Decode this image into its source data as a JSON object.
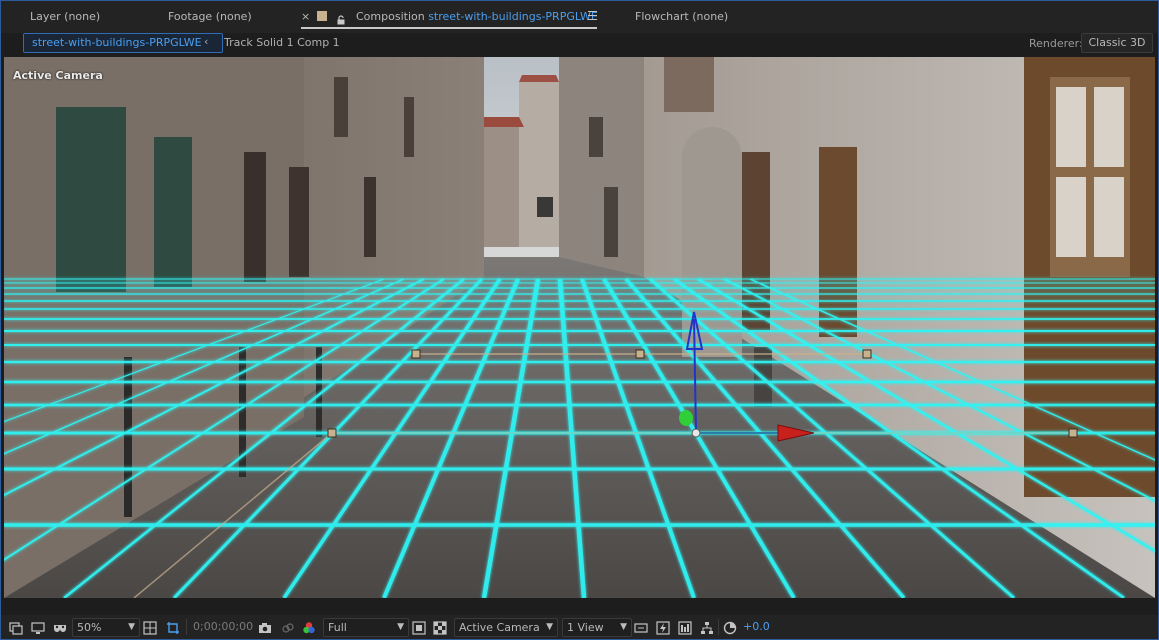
{
  "panel_tabs": {
    "layer": "Layer (none)",
    "footage": "Footage (none)",
    "composition_prefix": "Composition",
    "composition_name": "street-with-buildings-PRPGLWE",
    "flowchart": "Flowchart (none)",
    "close_glyph": "×"
  },
  "breadcrumbs": {
    "current": "street-with-buildings-PRPGLWE",
    "chevron": "‹",
    "next": "Track Solid 1 Comp 1"
  },
  "renderer": {
    "label": "Renderer:",
    "value": "Classic 3D"
  },
  "viewer": {
    "overlay_label": "Active Camera"
  },
  "toolbar": {
    "magnification": "50%",
    "timecode": "0;00;00;00",
    "resolution": "Full",
    "camera_view": "Active Camera",
    "view_layout": "1 View",
    "exposure": "+0.0"
  },
  "colors": {
    "accent": "#4a9ff0",
    "grid": "#2ff4f4",
    "axis_y": "#2233c8",
    "axis_x": "#c8201c",
    "axis_z": "#2fcf3a",
    "track_point": "#c8b18e"
  },
  "icons": [
    "always-preview-icon",
    "monitor-icon",
    "mask-toggle-icon",
    "grid-guides-icon",
    "roi-icon",
    "transparency-grid-icon",
    "snapshot-icon",
    "show-snapshot-icon",
    "color-channels-icon",
    "fast-preview-icon",
    "toggle-transparency-icon",
    "draft-3d-icon",
    "fast-previews-icon",
    "timeline-icon",
    "flowchart-icon",
    "reset-exposure-icon"
  ]
}
